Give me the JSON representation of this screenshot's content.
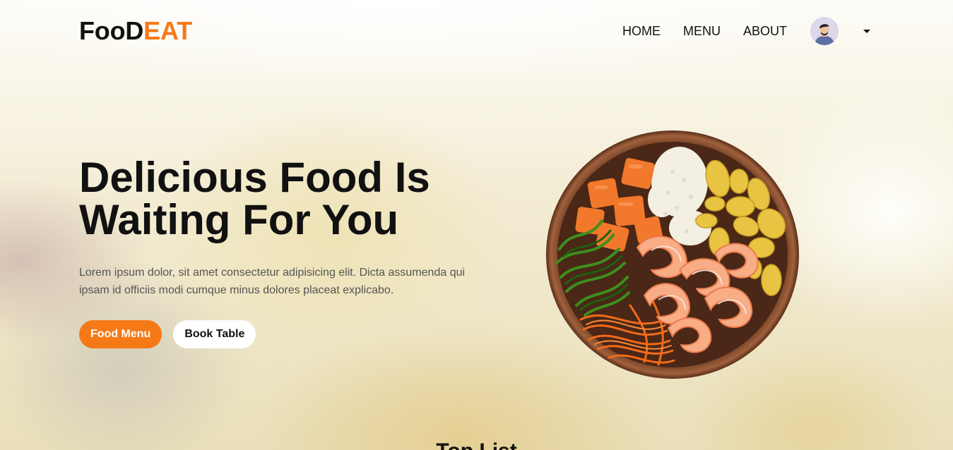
{
  "logo": {
    "part1": "FooD",
    "part2": "EAT"
  },
  "nav": {
    "home": "HOME",
    "menu": "MENU",
    "about": "ABOUT"
  },
  "hero": {
    "title": "Delicious Food Is Waiting For You",
    "text": "Lorem ipsum dolor, sit amet consectetur adipisicing elit. Dicta assumenda qui ipsam id officiis modi cumque minus dolores placeat explicabo.",
    "primary_button": "Food Menu",
    "secondary_button": "Book Table"
  },
  "next_section": {
    "title": "Top List"
  },
  "colors": {
    "accent": "#f57a17",
    "text": "#111111",
    "body_text": "#555555"
  },
  "icons": {
    "avatar": "user-avatar",
    "dropdown": "caret-down-icon"
  }
}
